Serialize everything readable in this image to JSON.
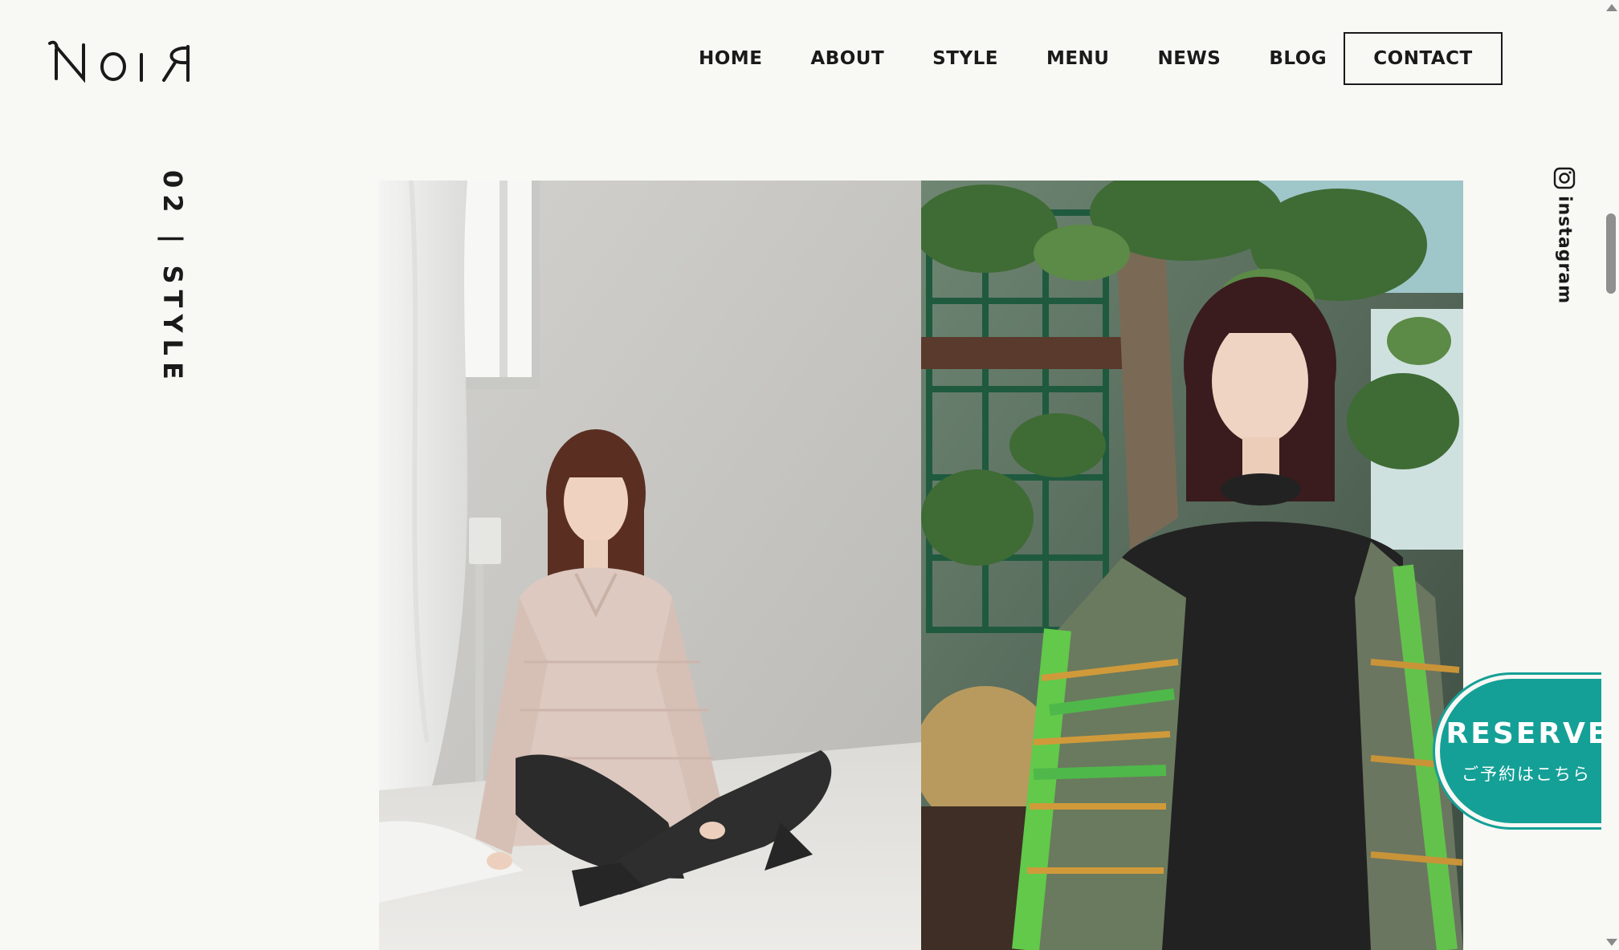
{
  "header": {
    "logo_text": "NOIR",
    "nav": [
      {
        "label": "HOME"
      },
      {
        "label": "ABOUT"
      },
      {
        "label": "STYLE"
      },
      {
        "label": "MENU"
      },
      {
        "label": "NEWS"
      },
      {
        "label": "BLOG"
      }
    ],
    "contact_label": "CONTACT"
  },
  "section": {
    "label": "02 | STYLE"
  },
  "photos": [
    {
      "name": "style-photo-left",
      "subject": "woman-sitting-cross-legged"
    },
    {
      "name": "style-photo-right",
      "subject": "woman-under-tree"
    }
  ],
  "social": {
    "instagram_label": "instagram",
    "icon": "instagram-icon"
  },
  "reserve": {
    "title": "RESERVE",
    "subtitle": "ご予約はこちら"
  },
  "colors": {
    "background": "#f8f8f4",
    "text": "#1a1a1a",
    "accent": "#14a096"
  }
}
